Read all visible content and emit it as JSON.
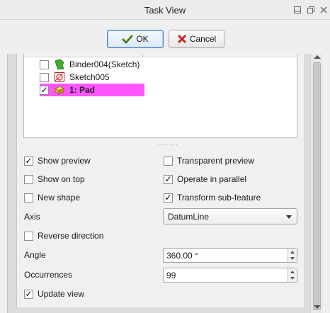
{
  "window": {
    "title": "Task View"
  },
  "dialog_buttons": {
    "ok_label": "OK",
    "cancel_label": "Cancel"
  },
  "tree": {
    "items": [
      {
        "label": "Binder004(Sketch)",
        "checked": false,
        "icon": "binder-icon",
        "selected": false
      },
      {
        "label": "Sketch005",
        "checked": false,
        "icon": "sketch-icon",
        "selected": false
      },
      {
        "label": "1: Pad",
        "checked": true,
        "icon": "pad-icon",
        "selected": true
      }
    ]
  },
  "options": {
    "show_preview": {
      "label": "Show preview",
      "checked": true
    },
    "transparent_preview": {
      "label": "Transparent preview",
      "checked": false
    },
    "show_on_top": {
      "label": "Show on top",
      "checked": false
    },
    "operate_in_parallel": {
      "label": "Operate in parallel",
      "checked": true
    },
    "new_shape": {
      "label": "New shape",
      "checked": false
    },
    "transform_sub_feature": {
      "label": "Transform sub-feature",
      "checked": true
    },
    "reverse_direction": {
      "label": "Reverse direction",
      "checked": false
    },
    "update_view": {
      "label": "Update view",
      "checked": true
    }
  },
  "axis": {
    "label": "Axis",
    "value": "DatumLine"
  },
  "angle": {
    "label": "Angle",
    "value": "360.00 °"
  },
  "occurrences": {
    "label": "Occurrences",
    "value": "99"
  },
  "colors": {
    "selection_highlight": "#ff55ff",
    "primary_button_border": "#4a7fc0"
  }
}
